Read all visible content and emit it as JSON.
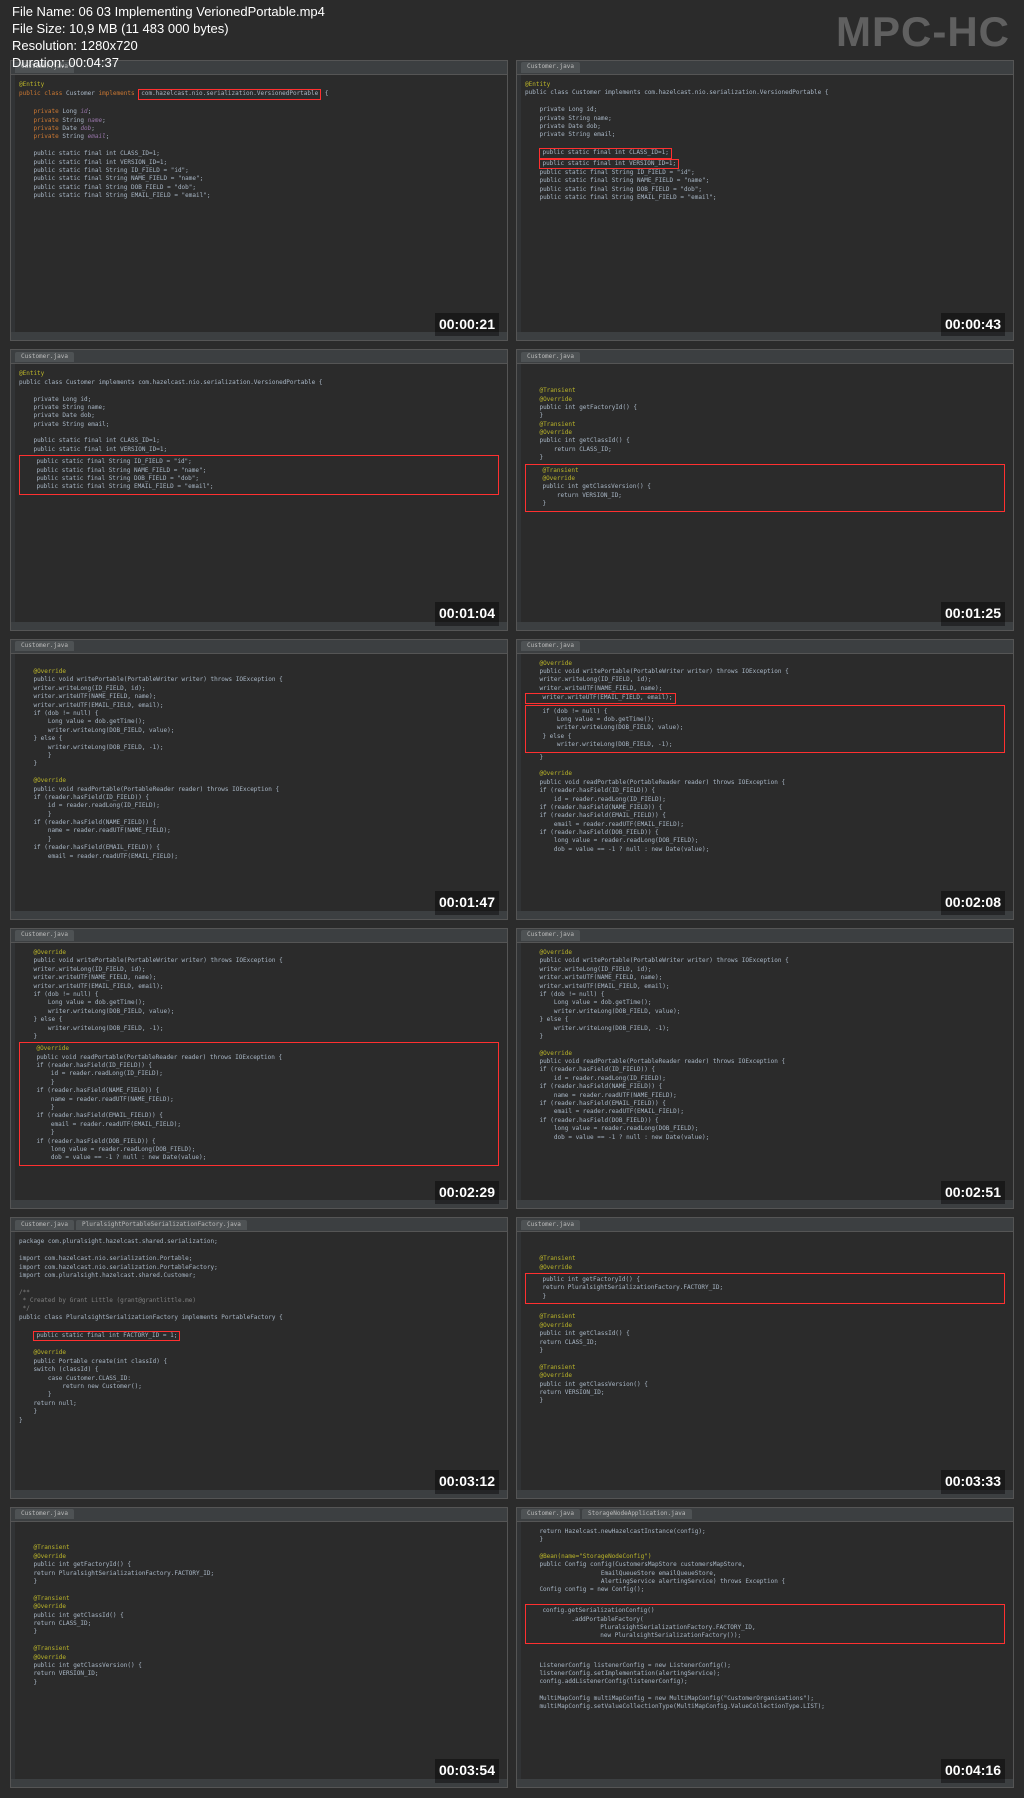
{
  "watermark": "MPC-HC",
  "file_info": {
    "name_label": "File Name: 06 03 Implementing VerionedPortable.mp4",
    "size_label": "File Size: 10,9 MB (11 483 000 bytes)",
    "resolution_label": "Resolution: 1280x720",
    "duration_label": "Duration: 00:04:37"
  },
  "tab_name": "Customer.java",
  "tab_name2": "PluralsightPortableSerializationFactory.java",
  "tab_name3": "StorageNodeApplication.java",
  "thumbs": [
    {
      "ts": "00:00:21"
    },
    {
      "ts": "00:00:43"
    },
    {
      "ts": "00:01:04"
    },
    {
      "ts": "00:01:25"
    },
    {
      "ts": "00:01:47"
    },
    {
      "ts": "00:02:08"
    },
    {
      "ts": "00:02:29"
    },
    {
      "ts": "00:02:51"
    },
    {
      "ts": "00:03:12"
    },
    {
      "ts": "00:03:33"
    },
    {
      "ts": "00:03:54"
    },
    {
      "ts": "00:04:16"
    }
  ],
  "code": {
    "entity": "@Entity",
    "class_decl": "public class Customer implements com.hazelcast.nio.serialization.VersionedPortable {",
    "priv_long": "private Long id;",
    "priv_str_name": "private String name;",
    "priv_date": "private Date dob;",
    "priv_str_email": "private String email;",
    "const_class": "public static final int CLASS_ID=1;",
    "const_ver": "public static final int VERSION_ID=1;",
    "const_id": "public static final String ID_FIELD = \"id\";",
    "const_name": "public static final String NAME_FIELD = \"name\";",
    "const_dob": "public static final String DOB_FIELD = \"dob\";",
    "const_email": "public static final String EMAIL_FIELD = \"email\";",
    "transient": "@Transient",
    "override": "@Override",
    "getFactory": "public int getFactoryId() {",
    "getFactoryRet": "    return PluralsightSerializationFactory.FACTORY_ID;",
    "getClass": "public int getClassId() {",
    "getClassRet": "    return CLASS_ID;",
    "getVersion": "public int getClassVersion() {",
    "getVersionRet": "    return VERSION_ID;",
    "writePortable": "public void writePortable(PortableWriter writer) throws IOException {",
    "writeLong": "    writer.writeLong(ID_FIELD, id);",
    "writeUTF1": "    writer.writeUTF(NAME_FIELD, name);",
    "writeUTF2": "    writer.writeUTF(EMAIL_FIELD, email);",
    "ifDob": "    if (dob != null) {",
    "longVal": "        Long value = dob.getTime();",
    "writeLong2": "        writer.writeLong(DOB_FIELD, value);",
    "elseC": "    } else {",
    "writeLong3": "        writer.writeLong(DOB_FIELD, -1);",
    "readPortable": "public void readPortable(PortableReader reader) throws IOException {",
    "ifHas1": "    if (reader.hasField(ID_FIELD)) {",
    "readId": "        id = reader.readLong(ID_FIELD);",
    "ifHas2": "    if (reader.hasField(NAME_FIELD)) {",
    "readName": "        name = reader.readUTF(NAME_FIELD);",
    "ifHas3": "    if (reader.hasField(EMAIL_FIELD)) {",
    "readEmail": "        email = reader.readUTF(EMAIL_FIELD);",
    "ifHas4": "    if (reader.hasField(DOB_FIELD)) {",
    "readDob": "        long value = reader.readLong(DOB_FIELD);",
    "dobAssign": "        dob = value == -1 ? null : new Date(value);",
    "package": "package com.pluralsight.hazelcast.shared.serialization;",
    "import1": "import com.hazelcast.nio.serialization.Portable;",
    "import2": "import com.hazelcast.nio.serialization.PortableFactory;",
    "import3": "import com.pluralsight.hazelcast.shared.Customer;",
    "comment": " * Created by Grant Little (grant@grantlittle.me)",
    "factoryClass": "public class PluralsightSerializationFactory implements PortableFactory {",
    "factoryId": "public static final int FACTORY_ID = 1;",
    "create": "public Portable create(int classId) {",
    "switch": "    switch (classId) {",
    "case": "        case Customer.CLASS_ID:",
    "retCust": "            return new Customer();",
    "retNull": "    return null;",
    "retHz": "    return Hazelcast.newHazelcastInstance(config);",
    "bean": "@Bean(name=\"StorageNodeConfig\")",
    "configMethod": "public Config config(CustomersMapStore customersMapStore,",
    "configArg2": "                     EmailQueueStore emailQueueStore,",
    "configArg3": "                     AlertingService alertingService) throws Exception {",
    "configNew": "    Config config = new Config();",
    "serConfig": "    config.getSerializationConfig()",
    "addFactory": "            .addPortableFactory(",
    "factoryArg1": "                    PluralsightSerializationFactory.FACTORY_ID,",
    "factoryArg2": "                    new PluralsightSerializationFactory());",
    "listener": "    ListenerConfig listenerConfig = new ListenerConfig();",
    "listenerImpl": "    listenerConfig.setImplementation(alertingService);",
    "addListener": "    config.addListenerConfig(listenerConfig);",
    "multimap": "    MultiMapConfig multiMapConfig = new MultiMapConfig(\"CustomerOrganisations\");",
    "multimap2": "    multiMapConfig.setValueCollectionType(MultiMapConfig.ValueCollectionType.LIST);"
  }
}
